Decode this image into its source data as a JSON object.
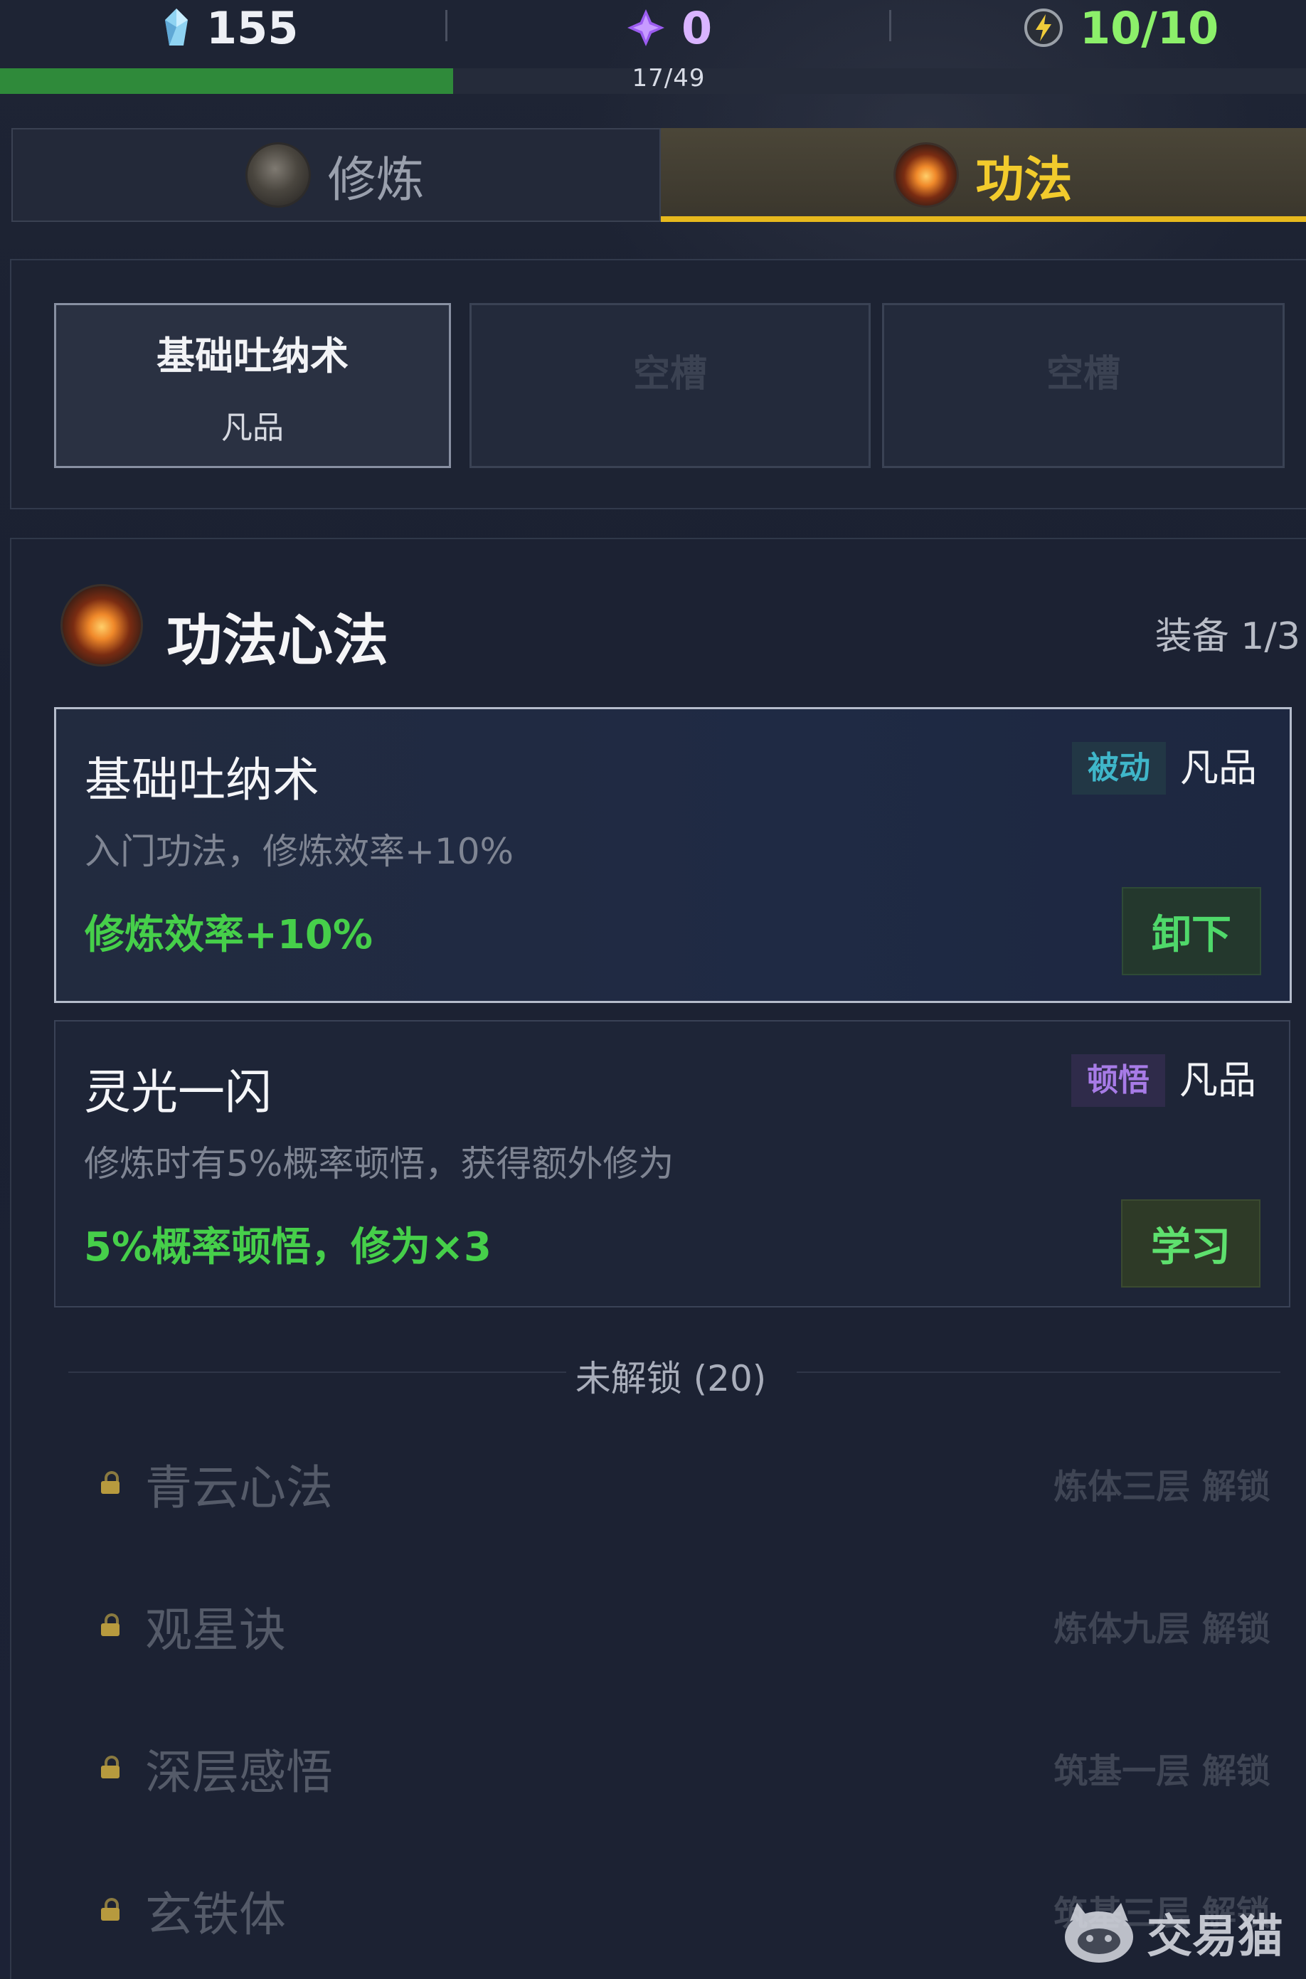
{
  "resources": {
    "spirit_stones": "155",
    "purple_gems": "0",
    "energy": "10/10",
    "progress_text": "17/49",
    "progress_fraction": 0.3469,
    "icons": [
      "crystal-icon",
      "purple-gem-icon",
      "lightning-icon"
    ]
  },
  "tabs": [
    {
      "label": "修炼",
      "icon": "cultivation-orb-icon",
      "active": false
    },
    {
      "label": "功法",
      "icon": "fire-orb-icon",
      "active": true
    }
  ],
  "slots": [
    {
      "name": "基础吐纳术",
      "grade": "凡品"
    },
    {
      "label": "空槽"
    },
    {
      "label": "空槽"
    }
  ],
  "section": {
    "title": "功法心法",
    "equipped_count": "装备 1/3",
    "icon": "fire-orb-icon"
  },
  "methods": [
    {
      "name": "基础吐纳术",
      "tag": "被动",
      "grade": "凡品",
      "description": "入门功法，修炼效率+10%",
      "effect": "修炼效率+10%",
      "action": "卸下"
    },
    {
      "name": "灵光一闪",
      "tag": "顿悟",
      "grade": "凡品",
      "description": "修炼时有5%概率顿悟，获得额外修为",
      "effect": "5%概率顿悟，修为×3",
      "action": "学习"
    }
  ],
  "locked": {
    "label": "未解锁 (20)",
    "items": [
      {
        "name": "青云心法",
        "requirement": "炼体三层 解锁"
      },
      {
        "name": "观星诀",
        "requirement": "炼体九层 解锁"
      },
      {
        "name": "深层感悟",
        "requirement": "筑基一层 解锁"
      },
      {
        "name": "玄铁体",
        "requirement": "筑基三层 解锁"
      }
    ]
  },
  "watermark": {
    "text": "交易猫"
  },
  "colors": {
    "accent_gold": "#e7b91d",
    "effect_green": "#46cf4a",
    "energy_green": "#8cf06a",
    "gem_purple": "#d9b4ff"
  }
}
